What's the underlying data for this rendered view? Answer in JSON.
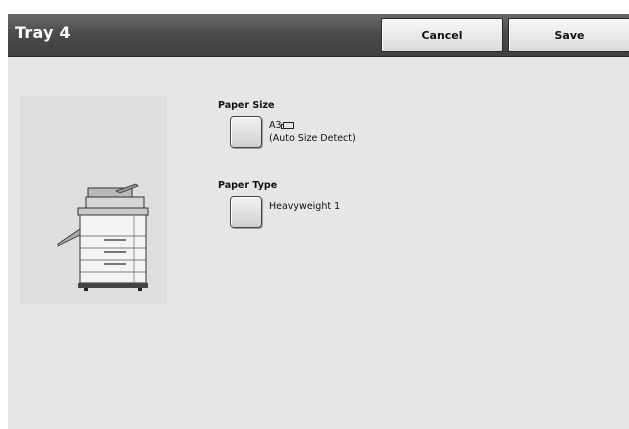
{
  "header": {
    "title": "Tray 4",
    "cancel_label": "Cancel",
    "save_label": "Save"
  },
  "paper_size": {
    "label": "Paper Size",
    "value": "A3",
    "orientation_icon": "paper-landscape-icon",
    "detail": "(Auto Size Detect)"
  },
  "paper_type": {
    "label": "Paper Type",
    "value": "Heavyweight 1"
  },
  "illustration": {
    "icon": "multifunction-printer-icon"
  }
}
